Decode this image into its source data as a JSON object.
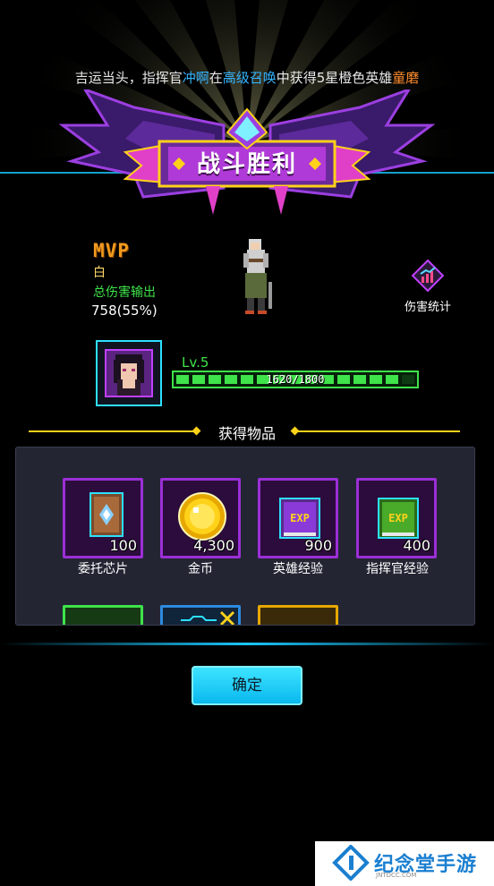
{
  "announcement": {
    "prefix": "吉运当头，指挥官",
    "player": "冲啊",
    "mid1": "在",
    "source": "高级召唤",
    "mid2": "中获得5星橙色英雄",
    "hero": "童磨"
  },
  "banner": {
    "title": "战斗胜利"
  },
  "mvp": {
    "badge": "MVP",
    "name": "白",
    "damage_label": "总伤害输出",
    "damage_value": "758(55%)"
  },
  "damage_stats": {
    "label": "伤害统计",
    "icon": "chart-icon"
  },
  "commander": {
    "level": "Lv.5",
    "xp_text": "1620/1800",
    "xp_fraction": 0.9
  },
  "rewards": {
    "title": "获得物品",
    "items": [
      {
        "name": "委托芯片",
        "qty": "100",
        "icon": "chip-card-icon"
      },
      {
        "name": "金币",
        "qty": "4,300",
        "icon": "gold-coin-icon"
      },
      {
        "name": "英雄经验",
        "qty": "900",
        "icon": "hero-exp-book-icon",
        "icon_text": "EXP"
      },
      {
        "name": "指挥官经验",
        "qty": "400",
        "icon": "commander-exp-book-icon",
        "icon_text": "EXP"
      }
    ]
  },
  "confirm_button": "确定",
  "watermark": {
    "text": "纪念堂手游",
    "sub": "JNTDCC.COM"
  },
  "colors": {
    "accent": "#19c8ff",
    "purple": "#9b2fd6",
    "green": "#3fe34a",
    "gold": "#ffd21a"
  }
}
